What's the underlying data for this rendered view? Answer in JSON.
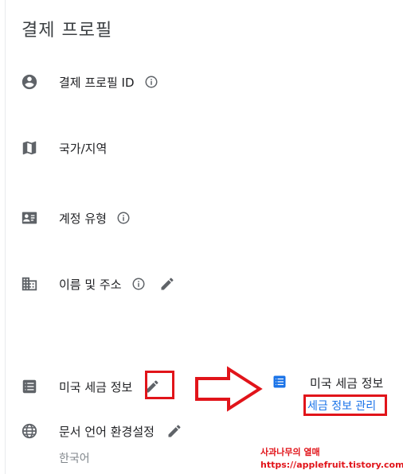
{
  "page": {
    "title": "결제 프로필"
  },
  "rows": {
    "profile_id": {
      "label": "결제 프로필 ID",
      "icon": "account-circle-icon"
    },
    "country": {
      "label": "국가/지역",
      "icon": "map-icon"
    },
    "account_type": {
      "label": "계정 유형",
      "icon": "contact-card-icon"
    },
    "name_address": {
      "label": "이름 및 주소",
      "icon": "building-icon"
    },
    "us_tax": {
      "label": "미국 세금 정보",
      "icon": "list-icon"
    },
    "doc_lang": {
      "label": "문서 언어 환경설정",
      "icon": "globe-icon",
      "value": "한국어"
    }
  },
  "tax_panel": {
    "title": "미국 세금 정보",
    "manage_link": "세금 정보 관리",
    "icon": "list-icon",
    "icon_color": "#1a73e8"
  },
  "annotation": {
    "blog_name": "사과나무의 열매",
    "blog_url": "https://applefruit.tistory.com/",
    "color": "#e1141a"
  }
}
